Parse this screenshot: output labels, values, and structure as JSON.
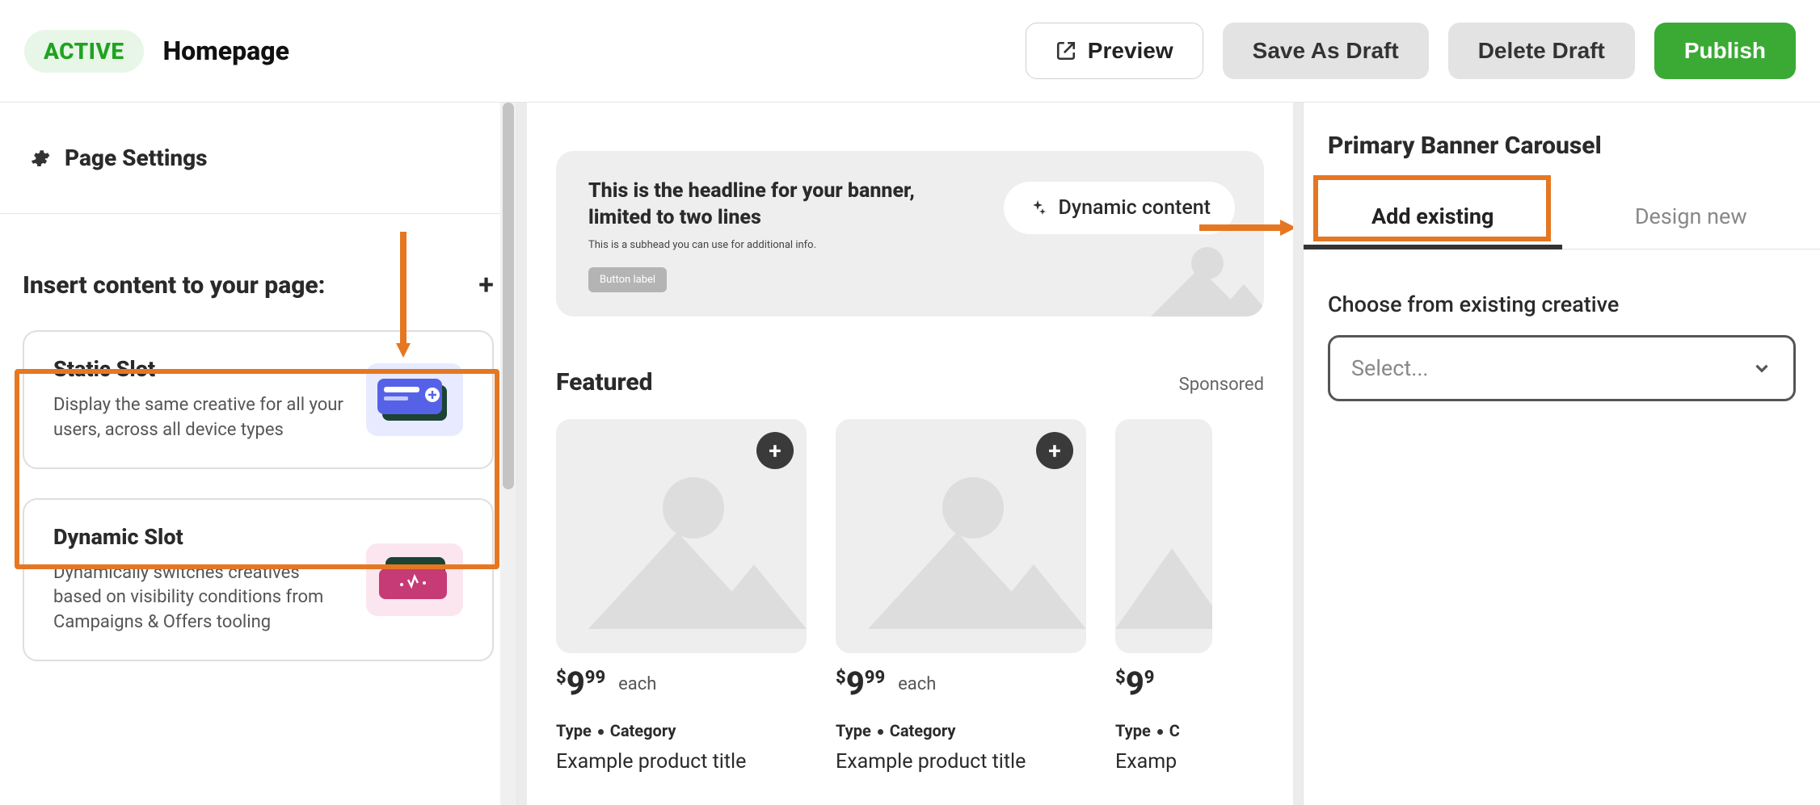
{
  "header": {
    "status": "ACTIVE",
    "title": "Homepage",
    "actions": {
      "preview": "Preview",
      "save_draft": "Save As Draft",
      "delete_draft": "Delete Draft",
      "publish": "Publish"
    }
  },
  "sidebar": {
    "page_settings": "Page Settings",
    "insert_header": "Insert content to your page:",
    "cards": {
      "static": {
        "title": "Static Slot",
        "desc": "Display the same creative for all your users, across all device types"
      },
      "dynamic": {
        "title": "Dynamic Slot",
        "desc": "Dynamically switches creatives based on visibility conditions from Campaigns & Offers tooling"
      }
    }
  },
  "canvas": {
    "banner": {
      "headline": "This is the headline for your banner, limited to two lines",
      "subhead": "This is a subhead you can use for additional info.",
      "button": "Button label"
    },
    "dynamic_pill": "Dynamic content",
    "featured_title": "Featured",
    "sponsored": "Sponsored",
    "products": [
      {
        "dollar": "$",
        "whole": "9",
        "cents": "99",
        "each": "each",
        "type_label": "Type",
        "category_label": "Category",
        "title": "Example product title"
      },
      {
        "dollar": "$",
        "whole": "9",
        "cents": "99",
        "each": "each",
        "type_label": "Type",
        "category_label": "Category",
        "title": "Example product title"
      },
      {
        "dollar": "$",
        "whole": "9",
        "cents": "9",
        "each": "",
        "type_label": "Type",
        "category_label": "C",
        "title": "Examp"
      }
    ]
  },
  "right_panel": {
    "title": "Primary Banner Carousel",
    "tabs": {
      "add_existing": "Add existing",
      "design_new": "Design new"
    },
    "choose_label": "Choose from existing creative",
    "select_placeholder": "Select..."
  }
}
